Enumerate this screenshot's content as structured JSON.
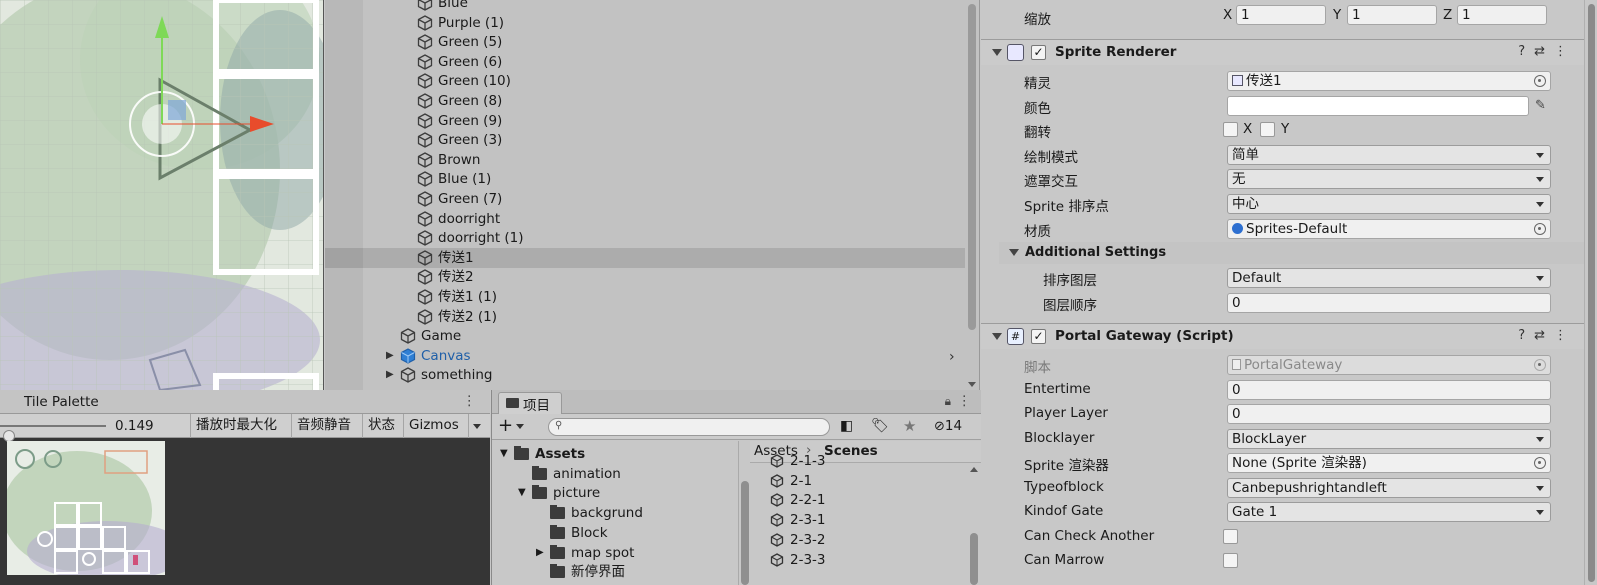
{
  "hierarchy": {
    "items": [
      {
        "label": "Blue",
        "indent": 2
      },
      {
        "label": "Purple (1)",
        "indent": 2
      },
      {
        "label": "Green (5)",
        "indent": 2
      },
      {
        "label": "Green (6)",
        "indent": 2
      },
      {
        "label": "Green (10)",
        "indent": 2
      },
      {
        "label": "Green (8)",
        "indent": 2
      },
      {
        "label": "Green (9)",
        "indent": 2
      },
      {
        "label": "Green (3)",
        "indent": 2
      },
      {
        "label": "Brown",
        "indent": 2
      },
      {
        "label": "Blue (1)",
        "indent": 2
      },
      {
        "label": "Green (7)",
        "indent": 2
      },
      {
        "label": "doorright",
        "indent": 2
      },
      {
        "label": "doorright (1)",
        "indent": 2
      },
      {
        "label": "传送1",
        "indent": 2,
        "selected": true
      },
      {
        "label": "传送2",
        "indent": 2
      },
      {
        "label": "传送1 (1)",
        "indent": 2
      },
      {
        "label": "传送2 (1)",
        "indent": 2
      },
      {
        "label": "Game",
        "indent": 1
      },
      {
        "label": "Canvas",
        "indent": 1,
        "expandable": true,
        "highlight": "blue"
      },
      {
        "label": "something",
        "indent": 1,
        "expandable": true
      }
    ]
  },
  "inspector": {
    "scale": {
      "label": "缩放",
      "x_label": "X",
      "x": "1",
      "y_label": "Y",
      "y": "1",
      "z_label": "Z",
      "z": "1"
    },
    "sprite_renderer": {
      "title": "Sprite Renderer",
      "sprite_label": "精灵",
      "sprite_value": "传送1",
      "color_label": "颜色",
      "flip_label": "翻转",
      "flip_x": "X",
      "flip_y": "Y",
      "draw_mode_label": "绘制模式",
      "draw_mode_value": "简单",
      "mask_label": "遮罩交互",
      "mask_value": "无",
      "sort_point_label": "Sprite 排序点",
      "sort_point_value": "中心",
      "material_label": "材质",
      "material_value": "Sprites-Default",
      "additional_settings": "Additional Settings",
      "sorting_layer_label": "排序图层",
      "sorting_layer_value": "Default",
      "order_label": "图层顺序",
      "order_value": "0"
    },
    "portal_gateway": {
      "title": "Portal Gateway (Script)",
      "script_label": "脚本",
      "script_value": "PortalGateway",
      "entertime_label": "Entertime",
      "entertime_value": "0",
      "player_layer_label": "Player Layer",
      "player_layer_value": "0",
      "blocklayer_label": "Blocklayer",
      "blocklayer_value": "BlockLayer",
      "sprite_renderer_label": "Sprite 渲染器",
      "sprite_renderer_value": "None (Sprite 渲染器)",
      "typeofblock_label": "Typeofblock",
      "typeofblock_value": "Canbepushrightandleft",
      "kindof_gate_label": "Kindof Gate",
      "kindof_gate_value": "Gate 1",
      "can_check_label": "Can Check Another",
      "can_marrow_label": "Can Marrow"
    }
  },
  "tile_palette": {
    "title": "Tile Palette",
    "scale_value": "0.149",
    "buttons": [
      "播放时最大化",
      "音频静音",
      "状态",
      "Gizmos"
    ]
  },
  "project": {
    "tab_label": "项目",
    "hidden_count": "14",
    "tree": [
      {
        "label": "Assets",
        "indent": 0,
        "bold": true,
        "expanded": true
      },
      {
        "label": "animation",
        "indent": 1
      },
      {
        "label": "picture",
        "indent": 1,
        "expanded": true
      },
      {
        "label": "backgrund",
        "indent": 2
      },
      {
        "label": "Block",
        "indent": 2
      },
      {
        "label": "map spot",
        "indent": 2,
        "expandable": true
      },
      {
        "label": "新停界面",
        "indent": 2
      }
    ],
    "breadcrumb": [
      "Assets",
      "Scenes"
    ],
    "files": [
      "2-1-3",
      "2-1",
      "2-2-1",
      "2-3-1",
      "2-3-2",
      "2-3-3"
    ]
  },
  "colors": {
    "selection": "#acacac",
    "blue_text": "#1f5fa8",
    "gizmo_green": "#7ed957",
    "gizmo_red": "#e84c2c"
  }
}
